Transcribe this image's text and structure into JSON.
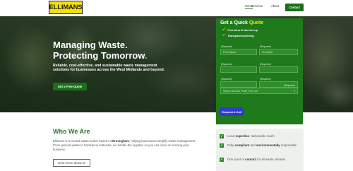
{
  "brand": {
    "logo_text": "ELLIMANS"
  },
  "nav": {
    "home": "Home",
    "services": "Services",
    "about": "About",
    "contact": "Contact"
  },
  "hero": {
    "title_line1": "Managing Waste.",
    "title_line2": "Protecting Tomorrow",
    "title_dot": ".",
    "description": "Reliable, cost-effective, and sustainable waste management solutions for businesses across the West Midlands and beyond.",
    "cta": "Get a Free Quote"
  },
  "form": {
    "title_prefix": "Get a Quick ",
    "title_accent": "Quote",
    "perks": [
      "Free bins & fast set up",
      "Transparent pricing"
    ],
    "required_label": "(Required)",
    "first_name_placeholder": "First Name",
    "surname_placeholder": "Surname",
    "service_placeholder": "Select Service From The List",
    "submit": "Request A Call"
  },
  "who": {
    "title": "Who We Are",
    "text_before": "Ellimans is a trusted waste broker based in ",
    "text_bold": "Birmingham",
    "text_after": ", helping businesses simplify waste management. From general waste to hazardous materials, we handle the logistics so you can focus on running your business.",
    "button": "Learn more about us"
  },
  "features": [
    {
      "before": "Local ",
      "bold": "expertise",
      "after": ", nationwide reach"
    },
    {
      "before": "Fully ",
      "bold": "compliant",
      "mid": " and ",
      "bold2": "environmentally",
      "after": " responsible"
    },
    {
      "before": "One point of ",
      "bold": "contact",
      "after": " for all waste streams"
    }
  ],
  "colors": {
    "brand_green": "#1b6f1a",
    "form_green": "#1f7a1c",
    "accent_yellow": "#f5e203",
    "submit_blue": "#2e3bd4",
    "title_green": "#2b7a24"
  }
}
